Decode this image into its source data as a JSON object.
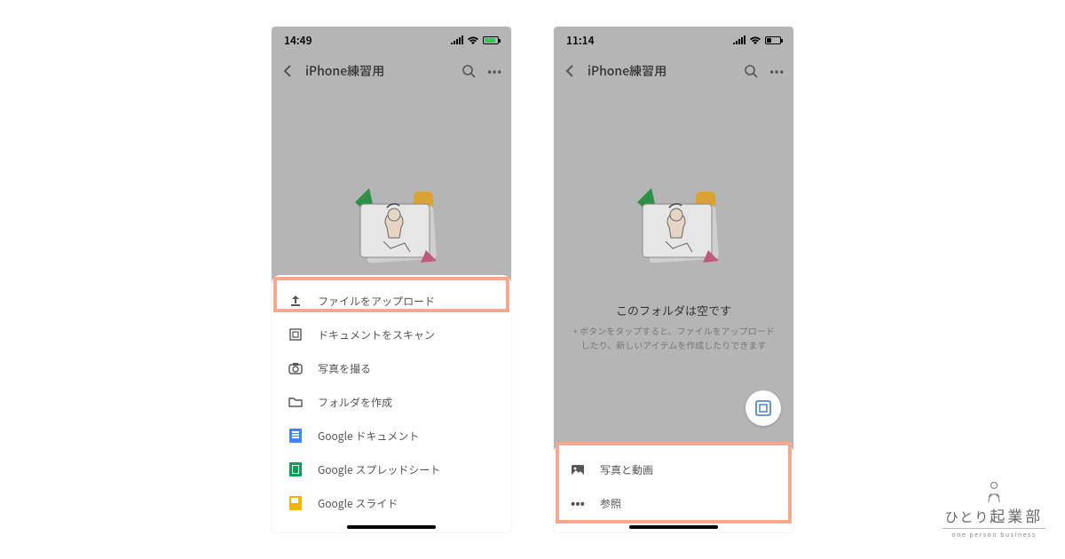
{
  "phone1": {
    "time": "14:49",
    "header": {
      "title": "iPhone練習用"
    },
    "sheet": [
      {
        "icon": "upload-icon",
        "label": "ファイルをアップロード"
      },
      {
        "icon": "scan-icon",
        "label": "ドキュメントをスキャン"
      },
      {
        "icon": "camera-icon",
        "label": "写真を撮る"
      },
      {
        "icon": "folder-icon",
        "label": "フォルダを作成"
      },
      {
        "icon": "google-doc-icon",
        "label": "Google ドキュメント"
      },
      {
        "icon": "google-sheet-icon",
        "label": "Google スプレッドシート"
      },
      {
        "icon": "google-slide-icon",
        "label": "Google スライド"
      }
    ]
  },
  "phone2": {
    "time": "11:14",
    "header": {
      "title": "iPhone練習用"
    },
    "empty": {
      "title": "このフォルダは空です",
      "subtitle": "+ ボタンをタップすると、ファイルをアップロードしたり、新しいアイテムを作成したりできます"
    },
    "sheet": [
      {
        "icon": "photos-icon",
        "label": "写真と動画"
      },
      {
        "icon": "browse-icon",
        "label": "参照"
      }
    ]
  },
  "logo": {
    "main": "ひとり起業部",
    "sub": "one person business"
  }
}
